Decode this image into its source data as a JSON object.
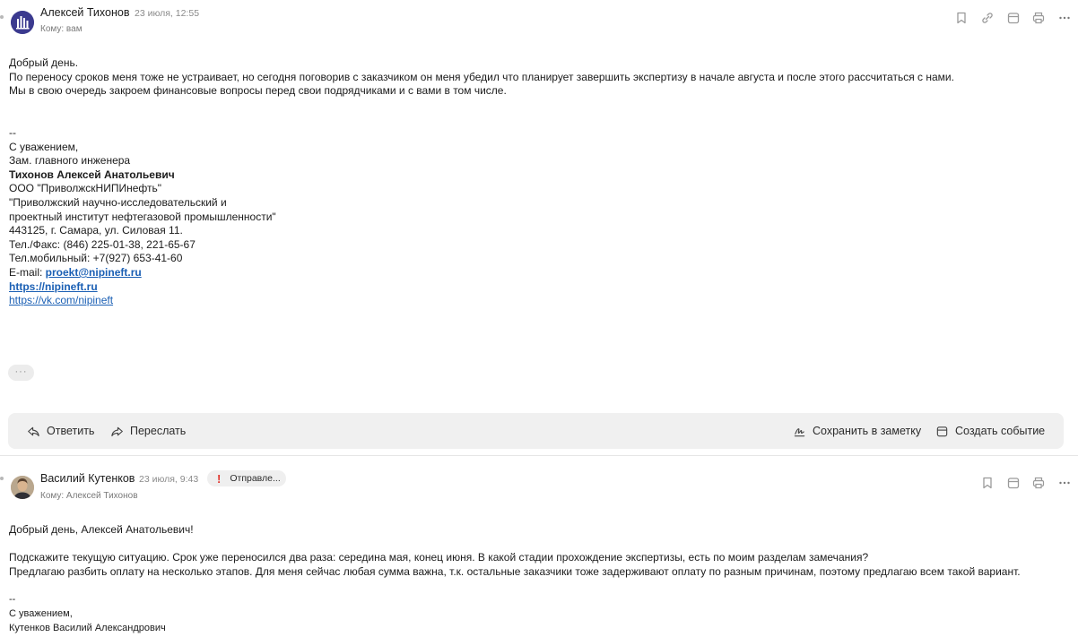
{
  "colors": {
    "accent_link": "#1a5fb4",
    "alert": "#e0342c",
    "action_bar_bg": "#f0f0f0",
    "avatar_primary": "#3b3a8f"
  },
  "message1": {
    "sender": "Алексей Тихонов",
    "date": "23 июля, 12:55",
    "to": "Кому: вам",
    "toolbar_icons": [
      "bookmark-icon",
      "link-icon",
      "calendar-icon",
      "print-icon",
      "more-icon"
    ],
    "body": {
      "greeting": "Добрый день.",
      "line1": "По переносу сроков меня тоже не устраивает, но сегодня поговорив с заказчиком он меня убедил что планирует завершить экспертизу в начале августа и после этого рассчитаться с нами.",
      "line2": "Мы в свою очередь закроем финансовые вопросы перед свои подрядчиками и с вами в том числе."
    },
    "signature": {
      "sep": "--",
      "regards": "С уважением,",
      "position": "Зам. главного инженера",
      "name": "Тихонов Алексей Анатольевич",
      "company": "ООО \"ПриволжскНИПИнефть\"",
      "institute1": "\"Приволжский научно-исследовательский и",
      "institute2": "проектный институт нефтегазовой промышленности\"",
      "address": "443125, г. Самара, ул. Силовая 11.",
      "phone": "Тел./Факс: (846) 225-01-38, 221-65-67",
      "mobile": "Тел.мобильный: +7(927) 653-41-60",
      "email_label": "E-mail: ",
      "email": "proekt@nipineft.ru",
      "site": "https://nipineft.ru",
      "vk": "https://vk.com/nipineft"
    },
    "more_label": "···",
    "actions": {
      "reply": "Ответить",
      "forward": "Переслать",
      "save_note": "Сохранить в заметку",
      "create_event": "Создать событие"
    }
  },
  "message2": {
    "sender": "Василий Кутенков",
    "date": "23 июля, 9:43",
    "status_badge": "Отправле...",
    "to": "Кому: Алексей Тихонов",
    "toolbar_icons": [
      "bookmark-icon",
      "calendar-icon",
      "print-icon",
      "more-icon"
    ],
    "body": {
      "greeting": "Добрый день, Алексей Анатольевич!",
      "line1": "Подскажите текущую ситуацию. Срок уже переносился два раза: середина мая, конец июня. В какой стадии прохождение экспертизы, есть по моим разделам замечания?",
      "line2": "Предлагаю разбить оплату на несколько этапов. Для меня сейчас любая сумма важна, т.к. остальные заказчики тоже задерживают оплату по разным причинам, поэтому предлагаю всем такой вариант."
    },
    "signature": {
      "sep": "--",
      "regards": "С уважением,",
      "name": "Кутенков Василий Александрович"
    }
  }
}
